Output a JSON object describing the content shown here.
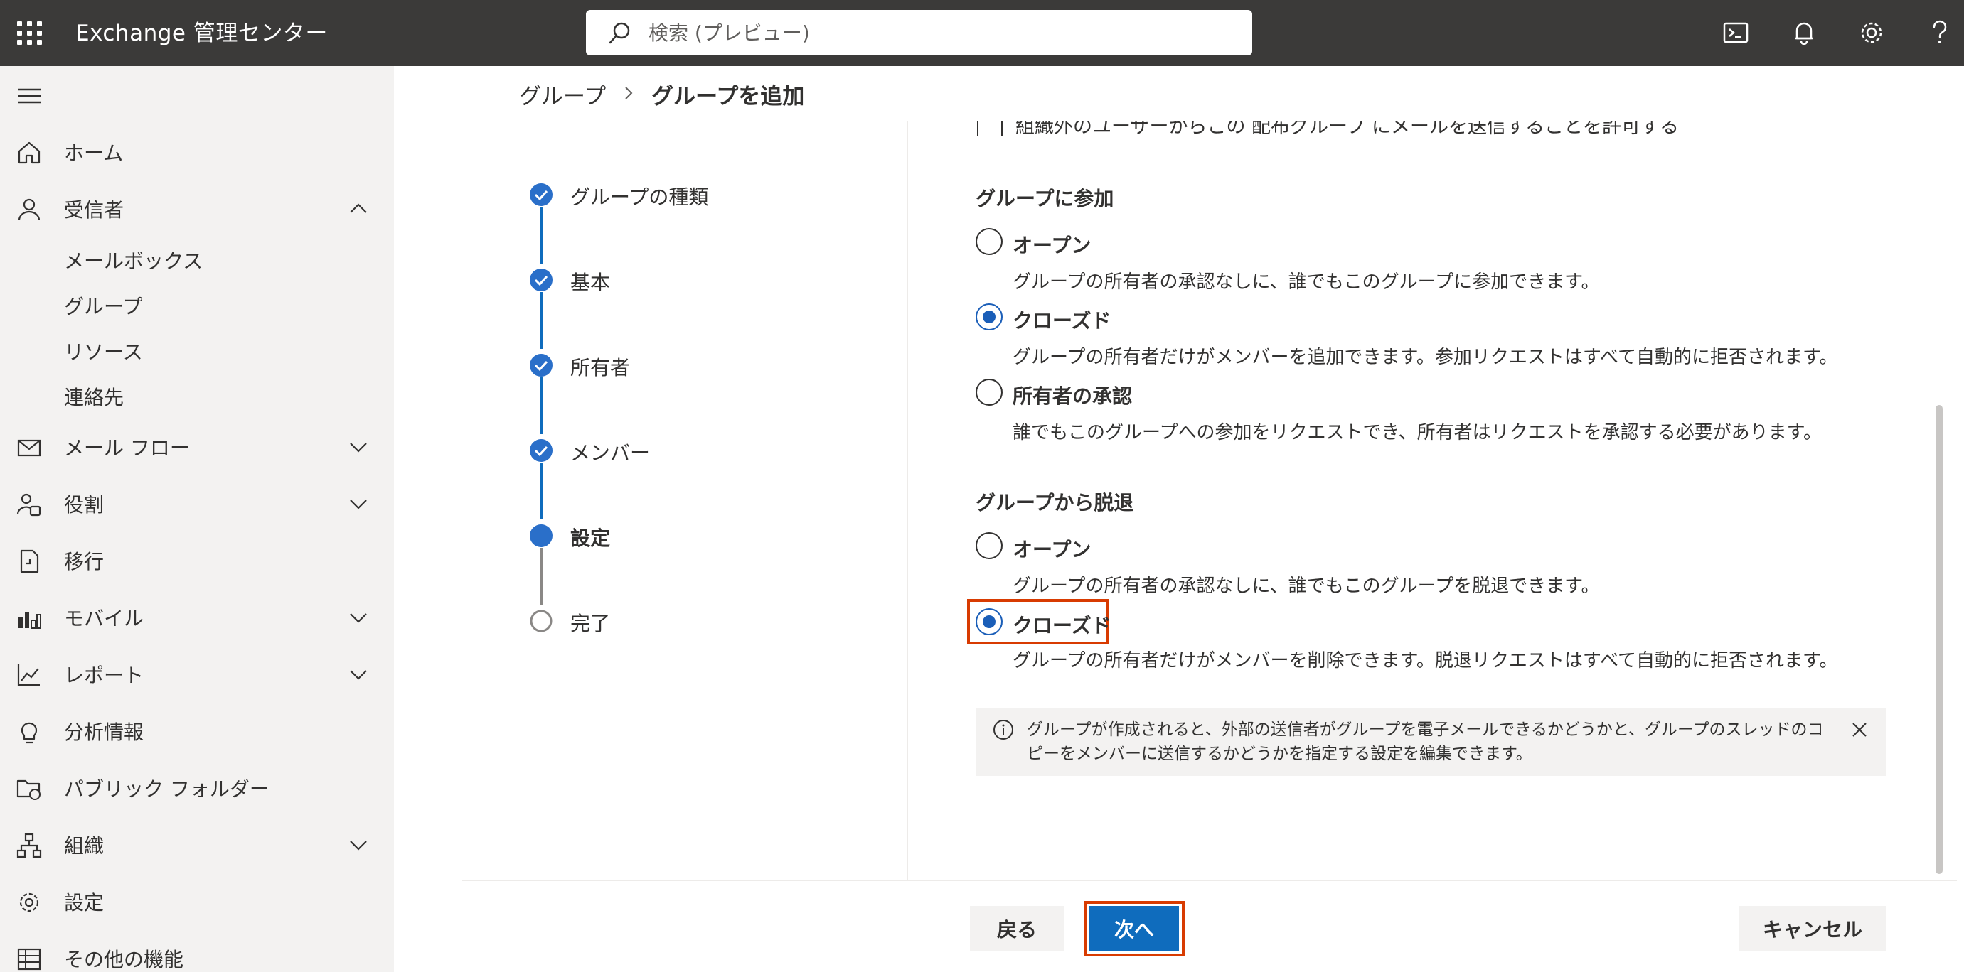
{
  "header": {
    "app_title": "Exchange 管理センター",
    "search_placeholder": "検索 (プレビュー)"
  },
  "nav": {
    "items": [
      {
        "label": "ホーム"
      },
      {
        "label": "受信者"
      },
      {
        "label": "メール フロー"
      },
      {
        "label": "役割"
      },
      {
        "label": "移行"
      },
      {
        "label": "モバイル"
      },
      {
        "label": "レポート"
      },
      {
        "label": "分析情報"
      },
      {
        "label": "パブリック フォルダー"
      },
      {
        "label": "組織"
      },
      {
        "label": "設定"
      },
      {
        "label": "その他の機能"
      }
    ],
    "recipients_sub": [
      "メールボックス",
      "グループ",
      "リソース",
      "連絡先"
    ]
  },
  "breadcrumb": {
    "parent": "グループ",
    "current": "グループを追加"
  },
  "wizard": {
    "steps": [
      {
        "label": "グループの種類",
        "status": "done"
      },
      {
        "label": "基本",
        "status": "done"
      },
      {
        "label": "所有者",
        "status": "done"
      },
      {
        "label": "メンバー",
        "status": "done"
      },
      {
        "label": "設定",
        "status": "current"
      },
      {
        "label": "完了",
        "status": "pending"
      }
    ]
  },
  "settings": {
    "cut_checkbox_label": "組織外のユーザーからこの 配布グループ にメールを送信することを許可する",
    "join": {
      "title": "グループに参加",
      "options": [
        {
          "label": "オープン",
          "desc": "グループの所有者の承認なしに、誰でもこのグループに参加できます。",
          "checked": false
        },
        {
          "label": "クローズド",
          "desc": "グループの所有者だけがメンバーを追加できます。参加リクエストはすべて自動的に拒否されます。",
          "checked": true
        },
        {
          "label": "所有者の承認",
          "desc": "誰でもこのグループへの参加をリクエストでき、所有者はリクエストを承認する必要があります。",
          "checked": false
        }
      ]
    },
    "leave": {
      "title": "グループから脱退",
      "options": [
        {
          "label": "オープン",
          "desc": "グループの所有者の承認なしに、誰でもこのグループを脱退できます。",
          "checked": false
        },
        {
          "label": "クローズド",
          "desc": "グループの所有者だけがメンバーを削除できます。脱退リクエストはすべて自動的に拒否されます。",
          "checked": true
        }
      ]
    },
    "info": "グループが作成されると、外部の送信者がグループを電子メールできるかどうかと、グループのスレッドのコピーをメンバーに送信するかどうかを指定する設定を編集できます。"
  },
  "footer": {
    "back": "戻る",
    "next": "次へ",
    "cancel": "キャンセル"
  },
  "colors": {
    "accent": "#0f6cbd",
    "highlight": "#d83b01",
    "topbar": "#3b3a39"
  }
}
